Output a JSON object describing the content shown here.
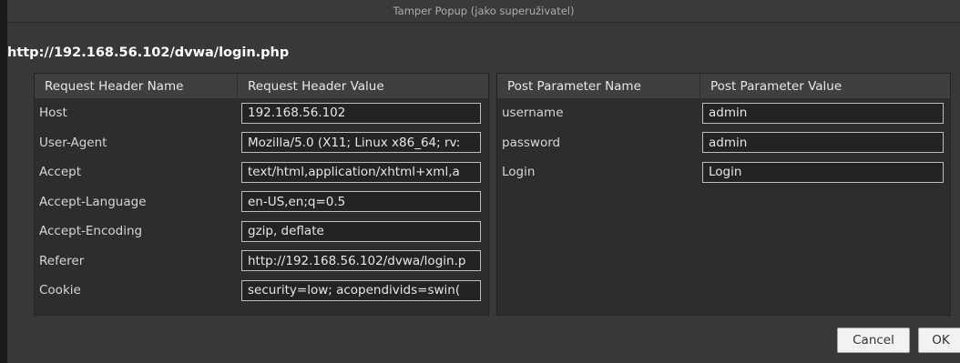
{
  "window": {
    "title": "Tamper Popup (jako superuživatel)"
  },
  "url": "http://192.168.56.102/dvwa/login.php",
  "headers": {
    "columns": [
      "Request Header Name",
      "Request Header Value"
    ],
    "rows": [
      {
        "name": "Host",
        "value": "192.168.56.102"
      },
      {
        "name": "User-Agent",
        "value": "Mozilla/5.0 (X11; Linux x86_64; rv:"
      },
      {
        "name": "Accept",
        "value": "text/html,application/xhtml+xml,a"
      },
      {
        "name": "Accept-Language",
        "value": "en-US,en;q=0.5"
      },
      {
        "name": "Accept-Encoding",
        "value": "gzip, deflate"
      },
      {
        "name": "Referer",
        "value": "http://192.168.56.102/dvwa/login.p"
      },
      {
        "name": "Cookie",
        "value": "security=low; acopendivids=swin("
      }
    ]
  },
  "post": {
    "columns": [
      "Post Parameter Name",
      "Post Parameter Value"
    ],
    "rows": [
      {
        "name": "username",
        "value": "admin"
      },
      {
        "name": "password",
        "value": "admin"
      },
      {
        "name": "Login",
        "value": "Login"
      }
    ]
  },
  "buttons": {
    "cancel": "Cancel",
    "ok": "OK"
  }
}
